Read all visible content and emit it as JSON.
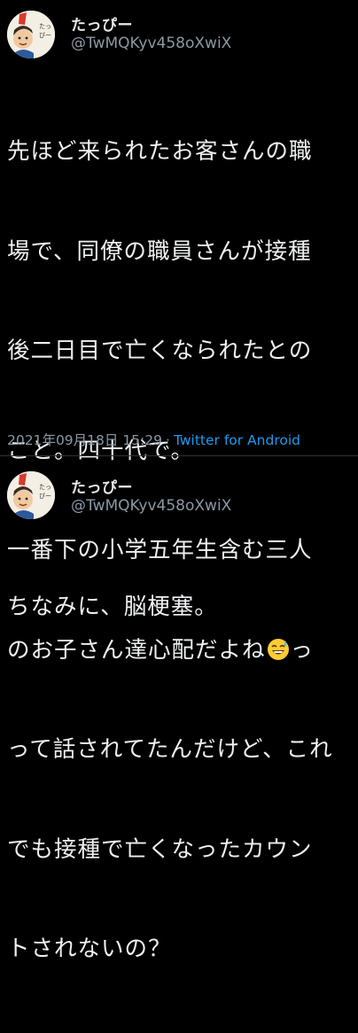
{
  "tweets": [
    {
      "display_name": "たっぴー",
      "handle": "@TwMQKyv458oXwiX",
      "avatar_icon": "cartoon-avatar",
      "lines": [
        "先ほど来られたお客さんの職",
        "場で、同僚の職員さんが接種",
        "後二日目で亡くなられたとの",
        "こと。四十代で。",
        "一番下の小学五年生含む三人",
        "のお子さん達心配だよね",
        "って話されてたんだけど、これ",
        "でも接種で亡くなったカウン",
        "トされないの？"
      ],
      "line6_after_emoji": "っ",
      "emoji_icon": "sweat-smile-emoji",
      "date": "2021年09月18日 15:29",
      "separator": "·",
      "source": "Twitter for Android"
    },
    {
      "display_name": "たっぴー",
      "handle": "@TwMQKyv458oXwiX",
      "avatar_icon": "cartoon-avatar",
      "lines": [
        "ちなみに、脳梗塞。"
      ]
    }
  ],
  "colors": {
    "background": "#000000",
    "text": "#e7e9ea",
    "secondary_text": "#8b98a5",
    "link": "#1d9bf0",
    "divider": "#2f3336"
  }
}
